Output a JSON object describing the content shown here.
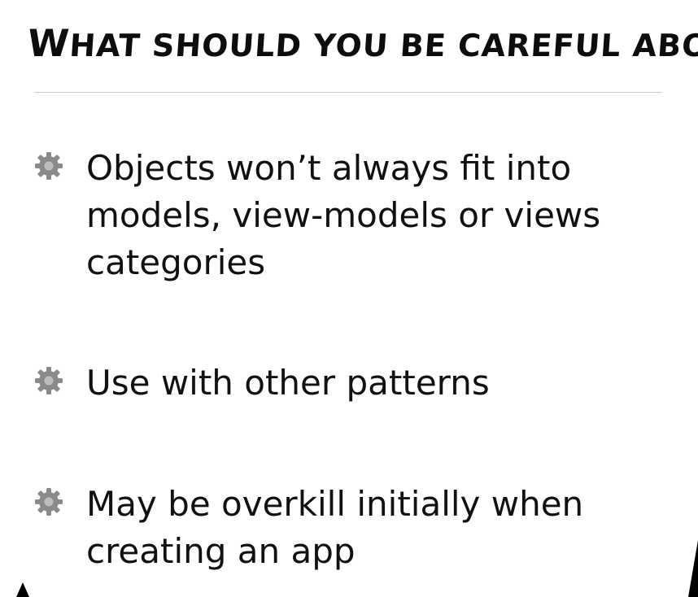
{
  "slide": {
    "title_first": "W",
    "title_rest": "hat should you be careful about?",
    "bullets": [
      {
        "icon": "gear-icon",
        "text": "Objects won’t always fit into models, view-models or views categories"
      },
      {
        "icon": "gear-icon",
        "text": "Use with other patterns"
      },
      {
        "icon": "gear-icon",
        "text": "May be overkill initially when creating an app"
      }
    ]
  },
  "colors": {
    "text": "#111111",
    "gear": "#8a8a8a",
    "divider": "#c9c9c9",
    "background": "#ffffff"
  }
}
